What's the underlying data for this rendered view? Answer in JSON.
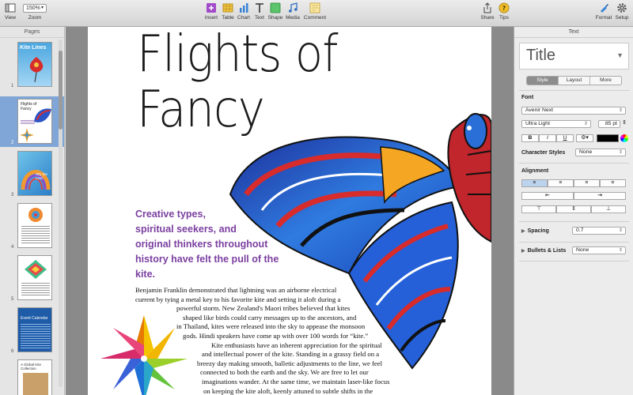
{
  "toolbar": {
    "view_label": "View",
    "zoom_value": "150%",
    "zoom_label": "Zoom",
    "insert_label": "Insert",
    "table_label": "Table",
    "chart_label": "Chart",
    "text_label": "Text",
    "shape_label": "Shape",
    "media_label": "Media",
    "comment_label": "Comment",
    "share_label": "Share",
    "tips_label": "Tips",
    "format_label": "Format",
    "setup_label": "Setup"
  },
  "pages_panel": {
    "header": "Pages",
    "thumbnails": [
      {
        "number": "1",
        "title": "Kite Lines"
      },
      {
        "number": "2",
        "title": "Flights of Fancy"
      },
      {
        "number": "3",
        "title": "Sky the Limit"
      },
      {
        "number": "4",
        "title": ""
      },
      {
        "number": "5",
        "title": ""
      },
      {
        "number": "6",
        "title": "Event Calendar"
      },
      {
        "number": "",
        "title": "A Global Kite Collection"
      }
    ],
    "selected_page": 2
  },
  "document": {
    "title_line1": "Flights of",
    "title_line2": "Fancy",
    "subhead_lines": [
      "Creative types,",
      "spiritual seekers, and",
      "original thinkers throughout",
      "history have felt the pull of the kite."
    ],
    "body_lines": [
      "Benjamin Franklin demonstrated that lightning was an airborne electrical",
      "current by tying a metal key to his favorite kite and setting it aloft during a",
      "powerful storm. New Zealand's Maori tribes believed that kites",
      "shaped like birds could carry messages up to the ancestors, and",
      "in Thailand, kites were released into the sky to appease the monsoon",
      "gods. Hindi speakers have come  up with over 100 words for “kite.”",
      "Kite enthusiasts have an inherent appreciation for the spiritual",
      "and intellectual power of the kite. Standing in a grassy field on a",
      "breezy day making smooth, balletic adjustments to the line, we feel",
      "connected to both the earth and the sky. We are free to let our",
      "imaginations wander. At the same time, we maintain laser-like focus",
      "on keeping the kite aloft, keenly attuned to subtle shifts in the"
    ],
    "colors": {
      "subhead": "#7b3fa0"
    }
  },
  "inspector": {
    "header": "Text",
    "paragraph_style": "Title",
    "tabs": [
      "Style",
      "Layout",
      "More"
    ],
    "active_tab": "Style",
    "font_label": "Font",
    "font_family": "Avenir Next",
    "font_weight": "Ultra Light",
    "font_size": "85 pt",
    "bold": "B",
    "italic": "I",
    "underline": "U",
    "char_styles_label": "Character Styles",
    "char_styles_value": "None",
    "alignment_label": "Alignment",
    "spacing_label": "Spacing",
    "spacing_value": "0.7",
    "bullets_label": "Bullets & Lists",
    "bullets_value": "None",
    "text_color": "#000000"
  }
}
